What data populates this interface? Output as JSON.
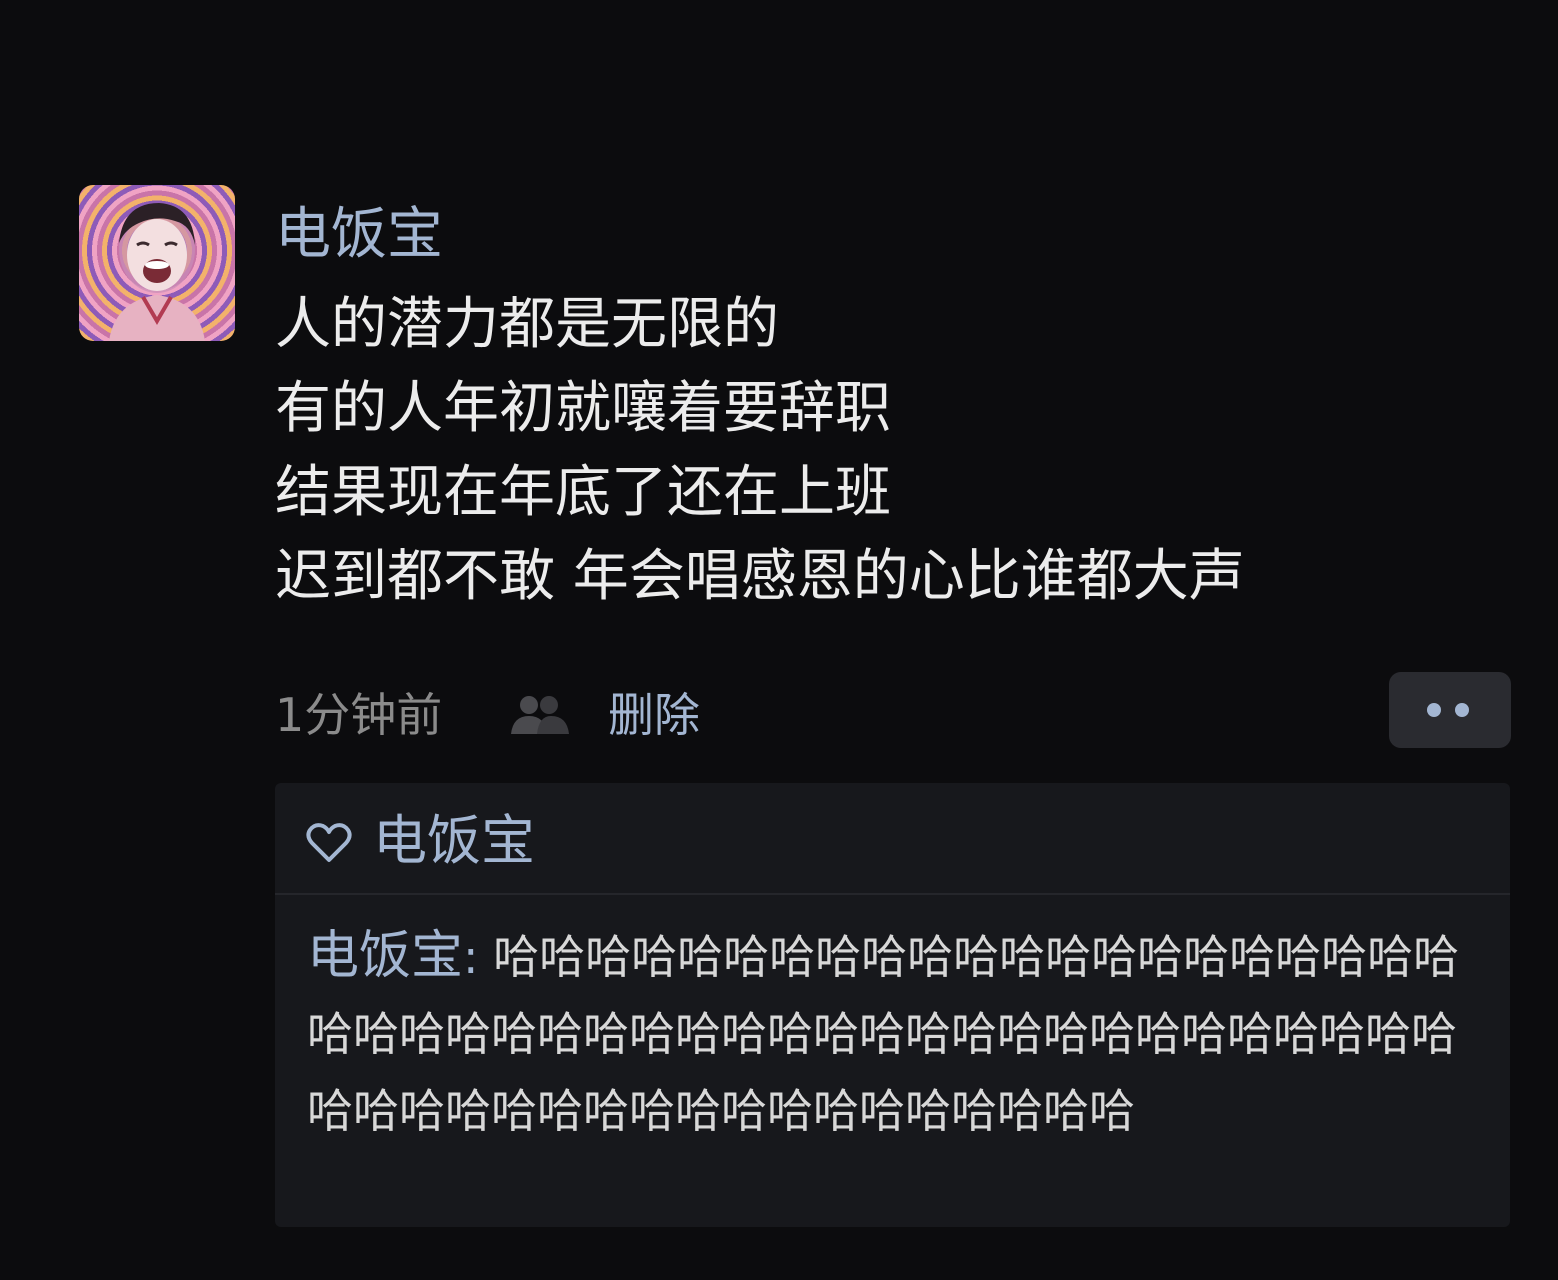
{
  "post": {
    "author": "电饭宝",
    "lines": [
      "人的潜力都是无限的",
      "有的人年初就嚷着要辞职",
      "结果现在年底了还在上班",
      "迟到都不敢 年会唱感恩的心比谁都大声"
    ],
    "time": "1分钟前",
    "delete_label": "删除",
    "visibility_icon": "people-icon",
    "more_icon": "two-dots-icon"
  },
  "likes": {
    "icon": "heart-icon",
    "names": "电饭宝"
  },
  "comment": {
    "author": "电饭宝",
    "separator": ": ",
    "text": "哈哈哈哈哈哈哈哈哈哈哈哈哈哈哈哈哈哈哈哈哈哈哈哈哈哈哈哈哈哈哈哈哈哈哈哈哈哈哈哈哈哈哈哈哈哈哈哈哈哈哈哈哈哈哈哈哈哈哈哈哈哈哈哈"
  },
  "colors": {
    "background": "#0c0c0e",
    "link": "#a3b6d2",
    "text": "#ececec",
    "muted": "#8b8b8b",
    "panel": "#17181c"
  }
}
